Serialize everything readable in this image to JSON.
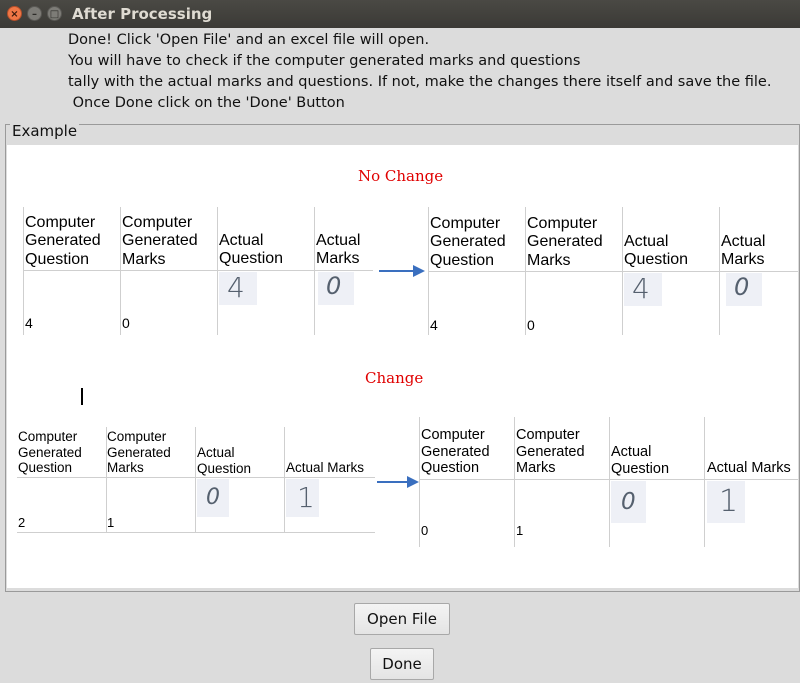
{
  "window": {
    "title": "After Processing",
    "controls": {
      "close": "×",
      "minimize": "–",
      "maximize": "□"
    }
  },
  "instructions": {
    "line1": "Done! Click 'Open File' and an excel file will open.",
    "line2": "You will have to check if the computer generated marks and questions",
    "line3": "tally with the actual marks and questions. If not, make the changes there itself and save the file.",
    "line4": " Once Done click on the 'Done' Button"
  },
  "example": {
    "legend": "Example",
    "no_change": {
      "caption": "No Change",
      "headers": [
        "Computer\nGenerated\nQuestion",
        "Computer\nGenerated\nMarks",
        "Actual\nQuestion",
        "Actual\nMarks"
      ],
      "before": {
        "cg_question": "4",
        "cg_marks": "0",
        "actual_question_hw": "4",
        "actual_marks_hw": "0"
      },
      "after": {
        "cg_question": "4",
        "cg_marks": "0",
        "actual_question_hw": "4",
        "actual_marks_hw": "0"
      }
    },
    "change": {
      "caption": "Change",
      "headers": [
        "Computer\nGenerated\nQuestion",
        "Computer\nGenerated\nMarks",
        "Actual\nQuestion",
        "Actual Marks"
      ],
      "before": {
        "cg_question": "2",
        "cg_marks": "1",
        "actual_question_hw": "0",
        "actual_marks_hw": "1"
      },
      "after": {
        "cg_question": "0",
        "cg_marks": "1",
        "actual_question_hw": "0",
        "actual_marks_hw": "1"
      }
    },
    "arrow_color": "#3a6fbf"
  },
  "buttons": {
    "open_file": "Open File",
    "done": "Done"
  }
}
